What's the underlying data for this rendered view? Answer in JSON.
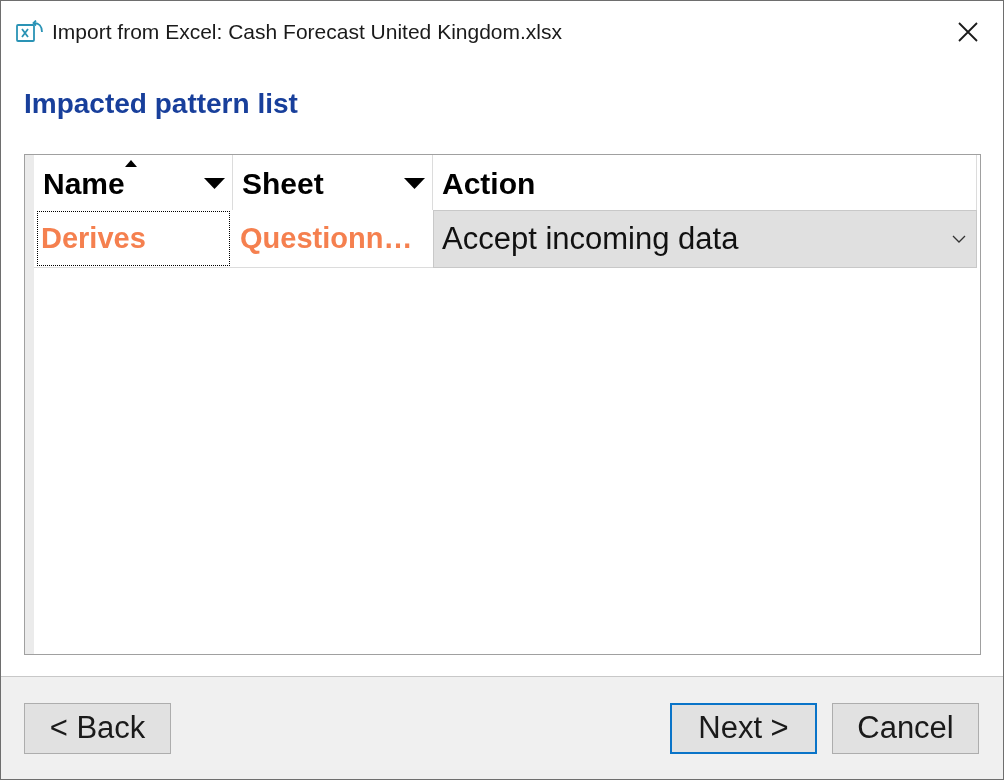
{
  "window": {
    "title": "Import from Excel: Cash Forecast United Kingdom.xlsx"
  },
  "heading": "Impacted pattern list",
  "table": {
    "columns": [
      {
        "label": "Name",
        "sorted": true,
        "filter": true
      },
      {
        "label": "Sheet",
        "sorted": false,
        "filter": true
      },
      {
        "label": "Action",
        "sorted": false,
        "filter": false
      }
    ],
    "rows": [
      {
        "cells": [
          {
            "kind": "text",
            "text": "Derives",
            "focused": true
          },
          {
            "kind": "text",
            "text": "Questionn…",
            "focused": false
          },
          {
            "kind": "dropdown",
            "value": "Accept incoming data",
            "focused": false
          }
        ]
      }
    ]
  },
  "footer": {
    "left_buttons": [
      {
        "label": "< Back",
        "default": false
      }
    ],
    "right_buttons": [
      {
        "label": "Next >",
        "default": true
      },
      {
        "label": "Cancel",
        "default": false
      }
    ]
  }
}
